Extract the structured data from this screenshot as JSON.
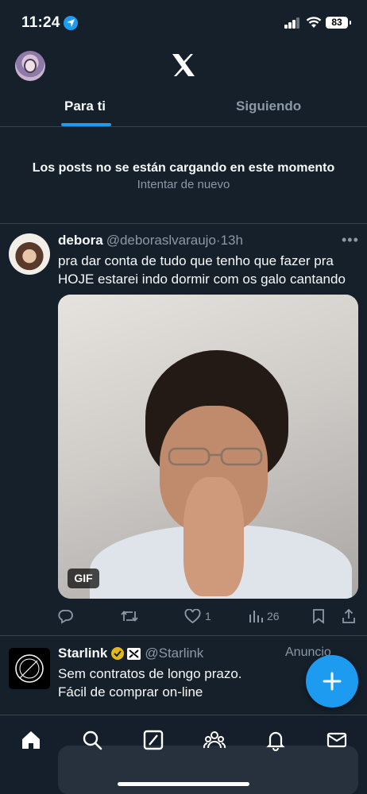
{
  "status_bar": {
    "time": "11:24",
    "battery": "83"
  },
  "header": {
    "logo": "x-logo-icon",
    "avatar": "user-avatar"
  },
  "tabs": [
    {
      "label": "Para ti",
      "active": true
    },
    {
      "label": "Siguiendo",
      "active": false
    }
  ],
  "error": {
    "message": "Los posts no se están cargando en este momento",
    "retry": "Intentar de nuevo"
  },
  "post": {
    "name": "debora",
    "handle": "@deboraslvaraujo",
    "time": "·13h",
    "text": "pra dar conta de tudo que tenho que fazer pra HOJE estarei indo dormir com os galo cantando",
    "media_badge": "GIF",
    "actions": {
      "replies": "",
      "reposts": "",
      "likes": "1",
      "views": "26"
    }
  },
  "ad": {
    "name": "Starlink",
    "handle": "@Starlink",
    "label": "Anuncio",
    "text_line1": "Sem contratos de longo prazo.",
    "text_line2": "Fácil de comprar on-line"
  },
  "colors": {
    "background": "#15202b",
    "accent": "#1d9bf0",
    "muted": "#8b98a5",
    "divider": "#38444d"
  },
  "nav": [
    "home-icon",
    "search-icon",
    "grok-icon",
    "communities-icon",
    "notifications-icon",
    "messages-icon"
  ]
}
